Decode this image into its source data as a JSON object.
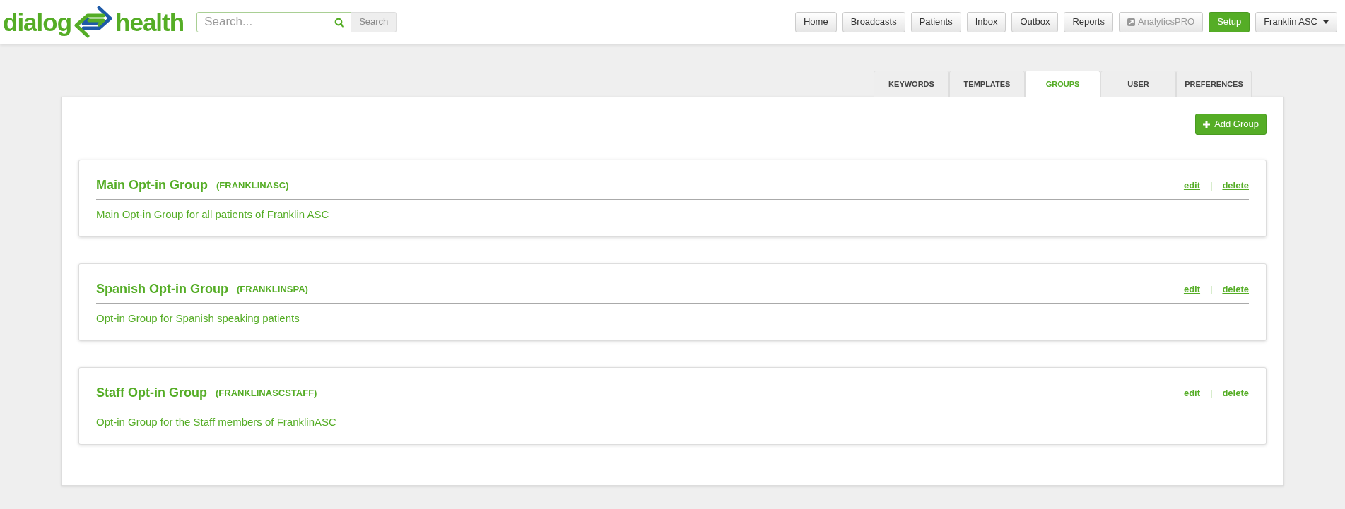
{
  "logo": {
    "left": "dialog",
    "right": "health"
  },
  "search": {
    "placeholder": "Search...",
    "button": "Search"
  },
  "nav": [
    {
      "label": "Home",
      "selected": false,
      "disabled": false
    },
    {
      "label": "Broadcasts",
      "selected": false,
      "disabled": false
    },
    {
      "label": "Patients",
      "selected": false,
      "disabled": false
    },
    {
      "label": "Inbox",
      "selected": false,
      "disabled": false
    },
    {
      "label": "Outbox",
      "selected": false,
      "disabled": false
    },
    {
      "label": "Reports",
      "selected": false,
      "disabled": false
    },
    {
      "label": "AnalyticsPRO",
      "selected": false,
      "disabled": true,
      "kind": "external"
    },
    {
      "label": "Setup",
      "selected": true,
      "disabled": false
    },
    {
      "label": "Franklin ASC",
      "selected": false,
      "disabled": false,
      "kind": "dropdown"
    }
  ],
  "tabs": [
    {
      "label": "KEYWORDS",
      "selected": false
    },
    {
      "label": "TEMPLATES",
      "selected": false
    },
    {
      "label": "GROUPS",
      "selected": true
    },
    {
      "label": "USER",
      "selected": false
    },
    {
      "label": "PREFERENCES",
      "selected": false
    }
  ],
  "add_button": "Add Group",
  "groups": [
    {
      "name": "Main Opt-in Group",
      "code": "(FRANKLINASC)",
      "description": "Main Opt-in Group for all patients of Franklin ASC",
      "edit": "edit",
      "separator": "|",
      "delete": "delete"
    },
    {
      "name": "Spanish Opt-in Group",
      "code": "(FRANKLINSPA)",
      "description": "Opt-in Group for Spanish speaking patients",
      "edit": "edit",
      "separator": "|",
      "delete": "delete"
    },
    {
      "name": "Staff Opt-in Group",
      "code": "(FRANKLINASCSTAFF)",
      "description": "Opt-in Group for the Staff members of FranklinASC",
      "edit": "edit",
      "separator": "|",
      "delete": "delete"
    }
  ]
}
